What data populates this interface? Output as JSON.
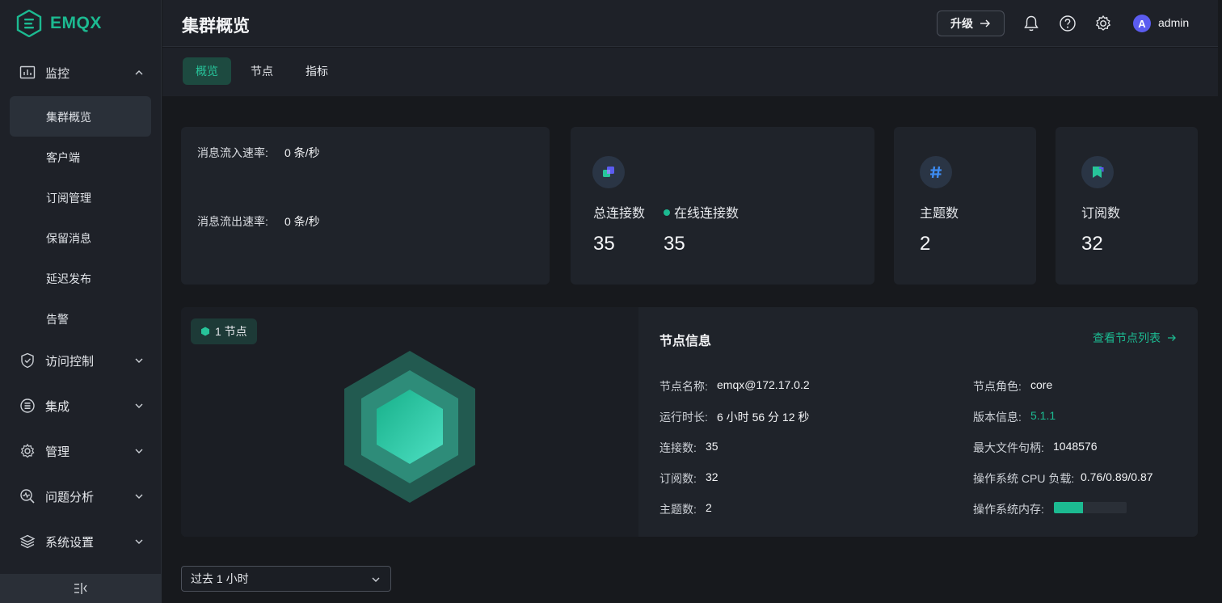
{
  "app": {
    "logo_text": "EMQX",
    "accent": "#1cba91"
  },
  "sidebar": {
    "groups": [
      {
        "label": "监控",
        "icon": "monitor-icon",
        "expanded": true
      },
      {
        "label": "访问控制",
        "icon": "shield-icon"
      },
      {
        "label": "集成",
        "icon": "integration-icon"
      },
      {
        "label": "管理",
        "icon": "gear-icon"
      },
      {
        "label": "问题分析",
        "icon": "analysis-icon"
      },
      {
        "label": "系统设置",
        "icon": "layers-icon"
      }
    ],
    "items": [
      {
        "label": "集群概览",
        "active": true
      },
      {
        "label": "客户端"
      },
      {
        "label": "订阅管理"
      },
      {
        "label": "保留消息"
      },
      {
        "label": "延迟发布"
      },
      {
        "label": "告警"
      }
    ],
    "collapse_icon": "collapse-sidebar-icon"
  },
  "header": {
    "title": "集群概览",
    "upgrade_label": "升级",
    "user_initial": "A",
    "username": "admin"
  },
  "tabs": [
    {
      "label": "概览",
      "active": true
    },
    {
      "label": "节点"
    },
    {
      "label": "指标"
    }
  ],
  "rates": {
    "in_label": "消息流入速率:",
    "in_value": "0 条/秒",
    "out_label": "消息流出速率:",
    "out_value": "0 条/秒"
  },
  "connections": {
    "total_label": "总连接数",
    "total_value": "35",
    "online_label": "在线连接数",
    "online_value": "35"
  },
  "topics": {
    "label": "主题数",
    "value": "2"
  },
  "subscriptions": {
    "label": "订阅数",
    "value": "32"
  },
  "node_badge": "1 节点",
  "node_info": {
    "title": "节点信息",
    "link": "查看节点列表",
    "left": [
      {
        "k": "节点名称:",
        "v": "emqx@172.17.0.2"
      },
      {
        "k": "运行时长:",
        "v": "6 小时 56 分 12 秒"
      },
      {
        "k": "连接数:",
        "v": "35"
      },
      {
        "k": "订阅数:",
        "v": "32"
      },
      {
        "k": "主题数:",
        "v": "2"
      }
    ],
    "right": [
      {
        "k": "节点角色:",
        "v": "core"
      },
      {
        "k": "版本信息:",
        "v": "5.1.1"
      },
      {
        "k": "最大文件句柄:",
        "v": "1048576"
      },
      {
        "k": "操作系统 CPU 负载:",
        "v": "0.76/0.89/0.87"
      },
      {
        "k": "操作系统内存:",
        "v": ""
      }
    ],
    "memory_usage": 0.4
  },
  "time_range": {
    "value": "过去 1 小时"
  }
}
